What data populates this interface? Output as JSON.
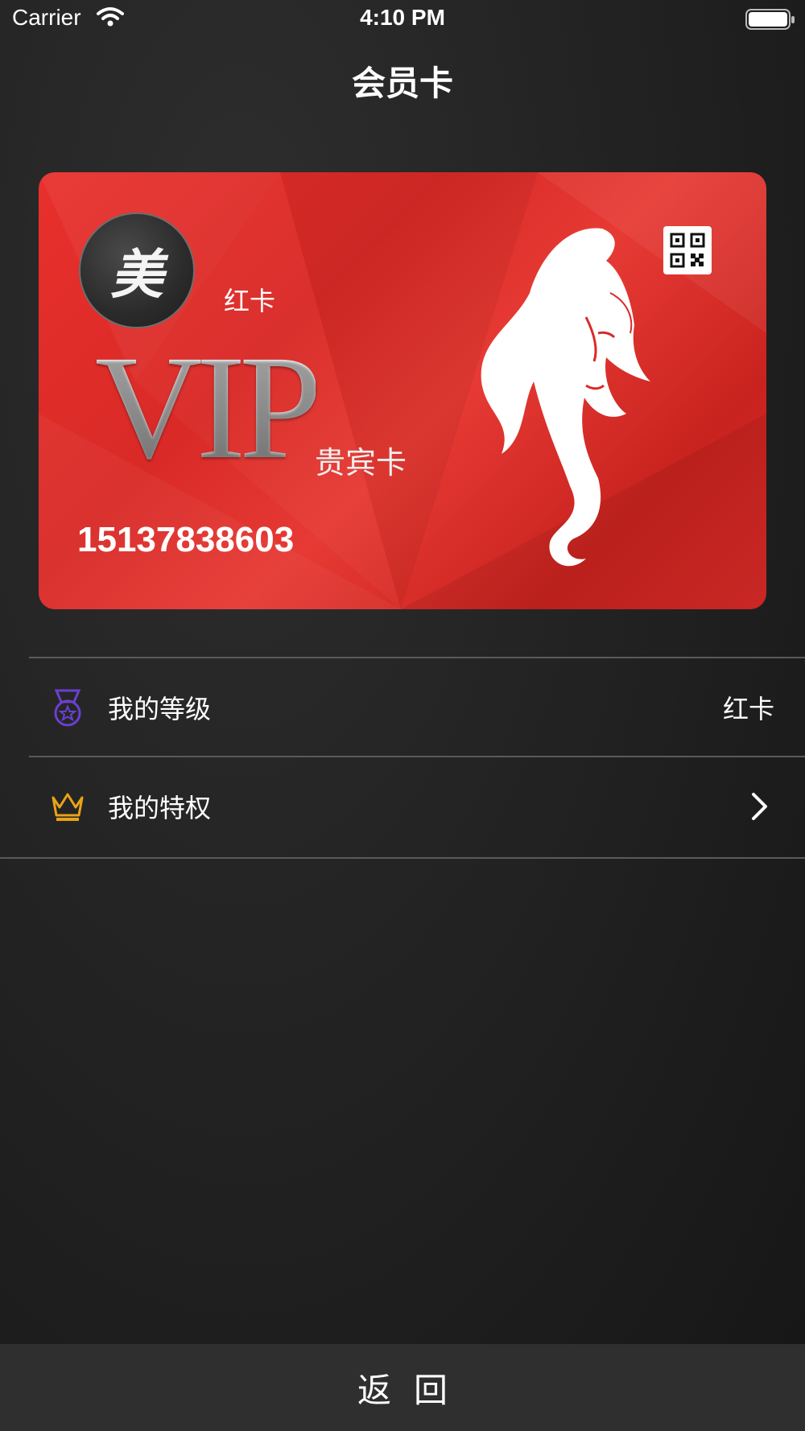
{
  "status_bar": {
    "carrier": "Carrier",
    "time": "4:10 PM"
  },
  "nav": {
    "title": "会员卡"
  },
  "card": {
    "logo_char": "美",
    "tier": "红卡",
    "vip_text": "VIP",
    "vip_subtitle": "贵宾卡",
    "number": "15137838603",
    "color": "#e0302c"
  },
  "rows": [
    {
      "label": "我的等级",
      "value": "红卡",
      "icon": "medal-icon",
      "icon_color": "#6b3fd1"
    },
    {
      "label": "我的特权",
      "icon": "crown-icon",
      "icon_color": "#e8a317"
    }
  ],
  "bottom": {
    "back_label": "返回"
  }
}
